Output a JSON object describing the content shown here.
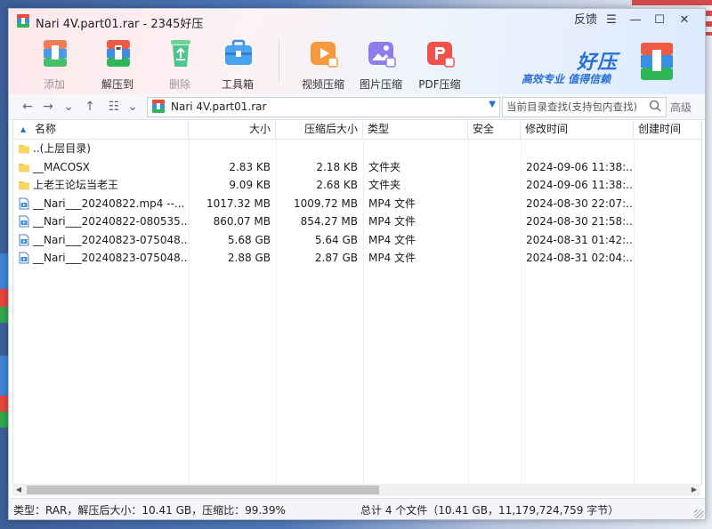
{
  "window": {
    "title": "Nari 4V.part01.rar - 2345好压",
    "feedback_label": "反馈",
    "menu_glyph": "☰",
    "minimize_glyph": "—",
    "maximize_glyph": "☐",
    "close_glyph": "✕"
  },
  "toolbar": {
    "buttons": [
      {
        "label": "添加",
        "icon": "add-archive-icon",
        "disabled": true
      },
      {
        "label": "解压到",
        "icon": "extract-icon",
        "disabled": false
      },
      {
        "label": "删除",
        "icon": "recycle-icon",
        "disabled": true
      },
      {
        "label": "工具箱",
        "icon": "toolbox-icon",
        "disabled": false
      },
      {
        "label": "视频压缩",
        "icon": "video-compress-icon",
        "disabled": false
      },
      {
        "label": "图片压缩",
        "icon": "image-compress-icon",
        "disabled": false
      },
      {
        "label": "PDF压缩",
        "icon": "pdf-compress-icon",
        "disabled": false
      }
    ]
  },
  "brand": {
    "name": "好压",
    "slogan": "高效专业  值得信赖"
  },
  "navbar": {
    "path": "Nari 4V.part01.rar",
    "search_placeholder": "当前目录查找(支持包内查找)",
    "advanced_label": "高级"
  },
  "columns": [
    "名称",
    "大小",
    "压缩后大小",
    "类型",
    "安全",
    "修改时间",
    "创建时间"
  ],
  "files": [
    {
      "name": "..(上层目录)",
      "size": "",
      "packed": "",
      "type": "",
      "security": "",
      "modified": "",
      "created": "",
      "icon": "folder-icon"
    },
    {
      "name": "__MACOSX",
      "size": "2.83 KB",
      "packed": "2.18 KB",
      "type": "文件夹",
      "security": "",
      "modified": "2024-09-06 11:38:...",
      "created": "",
      "icon": "folder-icon"
    },
    {
      "name": "上老王论坛当老王",
      "size": "9.09 KB",
      "packed": "2.68 KB",
      "type": "文件夹",
      "security": "",
      "modified": "2024-09-06 11:38:...",
      "created": "",
      "icon": "folder-icon"
    },
    {
      "name": "__Nari___20240822.mp4 --...",
      "size": "1017.32 MB",
      "packed": "1009.72 MB",
      "type": "MP4 文件",
      "security": "",
      "modified": "2024-08-30 22:07:...",
      "created": "",
      "icon": "video-file-icon"
    },
    {
      "name": "__Nari___20240822-080535...",
      "size": "860.07 MB",
      "packed": "854.27 MB",
      "type": "MP4 文件",
      "security": "",
      "modified": "2024-08-30 21:58:...",
      "created": "",
      "icon": "video-file-icon"
    },
    {
      "name": "__Nari___20240823-075048...",
      "size": "5.68 GB",
      "packed": "5.64 GB",
      "type": "MP4 文件",
      "security": "",
      "modified": "2024-08-31 01:42:...",
      "created": "",
      "icon": "video-file-icon"
    },
    {
      "name": "__Nari___20240823-075048...",
      "size": "2.88 GB",
      "packed": "2.87 GB",
      "type": "MP4 文件",
      "security": "",
      "modified": "2024-08-31 02:04:...",
      "created": "",
      "icon": "video-file-icon"
    }
  ],
  "status": {
    "left": "类型：RAR，解压后大小：10.41 GB，压缩比：99.39%",
    "right": "总计 4 个文件（10.41 GB，11,179,724,759 字节）"
  },
  "colors": {
    "accent": "#2a6fd6",
    "folder": "#f7c948",
    "header_bg_left": "#fde8ec",
    "header_bg_right": "#dceaff"
  }
}
